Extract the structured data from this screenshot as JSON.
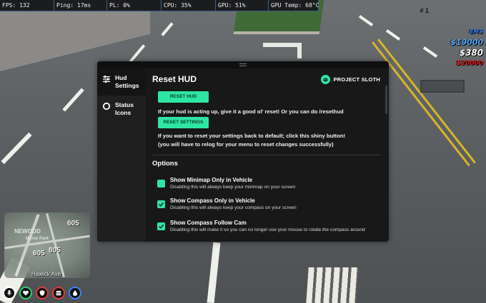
{
  "perf": {
    "fps": "FPS: 132",
    "ping": "Ping: 17ms",
    "pl": "PL: 0%",
    "cpu": "CPU: 35%",
    "gpu": "GPU: 51%",
    "gpu_temp": "GPU Temp: 68°C"
  },
  "hud_right": {
    "job": "# 1",
    "items": [
      {
        "text": "EMS",
        "color": "#3a86ff"
      },
      {
        "text": "$19000",
        "color": "#5aa9ff"
      },
      {
        "text": "$380",
        "color": "#ffffff"
      },
      {
        "text": "$20000",
        "color": "#e52525"
      }
    ]
  },
  "minimap": {
    "labels": [
      "NEWOOD",
      "Mirror Park"
    ],
    "numbers": [
      "605",
      "805",
      "605"
    ],
    "street": "Hawick Ave"
  },
  "status_icons": [
    {
      "name": "mic-icon",
      "color": "#ffffff"
    },
    {
      "name": "health-icon",
      "color": "#2ecc71"
    },
    {
      "name": "armor-icon",
      "color": "#e03a3a"
    },
    {
      "name": "hunger-icon",
      "color": "#e03a3a"
    },
    {
      "name": "thirst-icon",
      "color": "#3a86ff"
    }
  ],
  "panel": {
    "sidebar": [
      {
        "label": "Hud Settings",
        "icon": "sliders-icon"
      },
      {
        "label": "Status Icons",
        "icon": "circle-icon"
      }
    ],
    "title": "Reset HUD",
    "brand": "PROJECT SLOTH",
    "reset_hud_button": "RESET HUD",
    "reset_hud_desc": "If your hud is acting up, give it a good ol' reset! Or you can do /resethud",
    "reset_settings_button": "RESET SETTINGS",
    "reset_settings_desc": "If you want to reset your settings back to default; click this shiny button!",
    "reset_settings_note": "(you will have to relog for your menu to reset changes successfully)",
    "options_heading": "Options",
    "options": [
      {
        "title": "Show Minimap Only in Vehicle",
        "desc": "Disabling this will always keep your minimap on your screen",
        "checked": false
      },
      {
        "title": "Show Compass Only in Vehicle",
        "desc": "Disabling this will always keep your compass on your screen",
        "checked": true
      },
      {
        "title": "Show Compass Follow Cam",
        "desc": "Disabling this will make it so you can no longer use your mouse to rotate the compass around",
        "checked": true
      }
    ]
  },
  "colors": {
    "accent": "#2ee6a4",
    "panel_bg": "#181818"
  }
}
